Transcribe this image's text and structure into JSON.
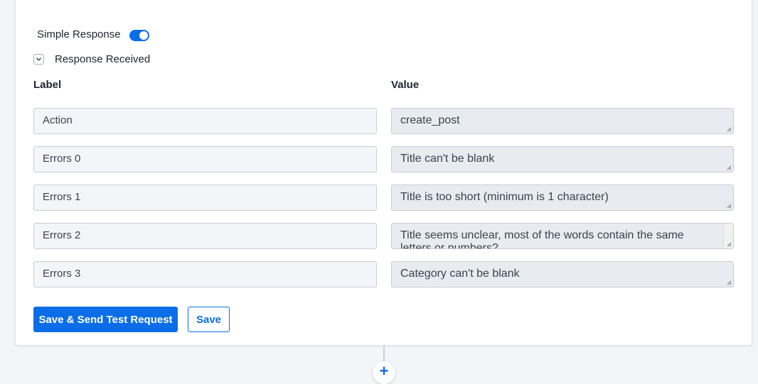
{
  "simple_response": {
    "label": "Simple Response",
    "enabled": true,
    "accent_color": "#0b6ee8"
  },
  "response_section": {
    "label": "Response Received",
    "expanded": true,
    "icon": "chevron-down-icon"
  },
  "columns": {
    "label_header": "Label",
    "value_header": "Value"
  },
  "rows": [
    {
      "label": "Action",
      "value": "create_post"
    },
    {
      "label": "Errors 0",
      "value": "Title can't be blank"
    },
    {
      "label": "Errors 1",
      "value": "Title is too short (minimum is 1 character)"
    },
    {
      "label": "Errors 2",
      "value": "Title seems unclear, most of the words contain the same letters or numbers?"
    },
    {
      "label": "Errors 3",
      "value": "Category can't be blank"
    }
  ],
  "buttons": {
    "save_and_test": "Save & Send Test Request",
    "save": "Save"
  },
  "add_step": {
    "glyph": "+",
    "icon": "plus-icon"
  }
}
